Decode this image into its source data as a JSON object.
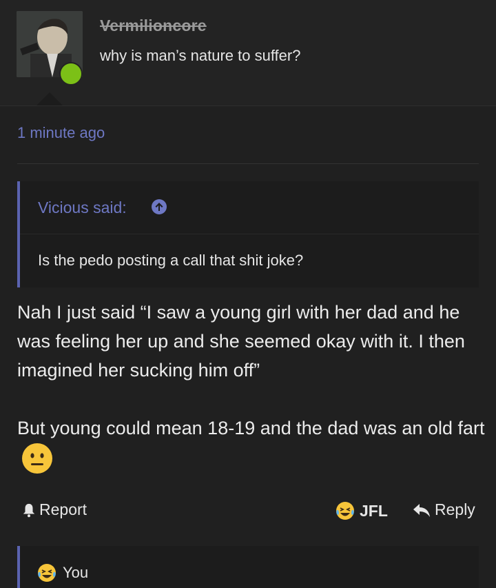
{
  "post": {
    "author": "Vermilioncore",
    "user_title": "why is man’s nature to suffer?",
    "timestamp": "1 minute ago"
  },
  "quote": {
    "author_label": "Vicious said:",
    "text": "Is the pedo posting a call that shit joke?"
  },
  "body": {
    "paragraph1": "Nah I just said “I saw a young girl with her dad and he was feeling her up and she seemed okay with it. I then imagined her sucking him off”",
    "paragraph2": "But young could mean 18-19 and the dad was an old fart"
  },
  "actions": {
    "report_label": "Report",
    "reaction_label": "JFL",
    "reply_label": "Reply"
  },
  "reactions": {
    "user": "You"
  },
  "colors": {
    "background": "#202020",
    "accent": "#6e78c4",
    "quote_border": "#5b63b0",
    "online_dot": "#7cc017"
  },
  "icons": {
    "status": "online-dot",
    "quote_jump": "arrow-up-circle-icon",
    "report": "bell-icon",
    "reaction": "laughing-crying-emoji-icon",
    "reply": "reply-arrow-icon",
    "body_emoji": "neutral-face-emoji"
  }
}
